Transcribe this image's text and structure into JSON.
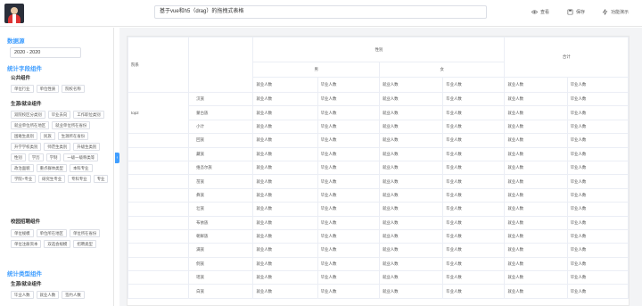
{
  "header": {
    "title": "基于vue和h5（drag）的拖拽式表格",
    "buttons": [
      {
        "icon": "eye-icon",
        "label": "查看"
      },
      {
        "icon": "save-icon",
        "label": "保存"
      },
      {
        "icon": "lightning-icon",
        "label": "功能演示"
      }
    ]
  },
  "sidebar": {
    "dataset_title": "数据源",
    "dataset_value": "2020 - 2020",
    "stat_title": "统计字段组件",
    "public_title": "公共组件",
    "public_chips": [
      "单位行业",
      "单位性质",
      "院校名称"
    ],
    "employment_title": "生源/就业组件",
    "employment_chips": [
      "双院校区分类别",
      "毕业去向",
      "工作职位类别",
      "就业单位所在地区",
      "就业单位所在省份",
      "困难生类别",
      "民族",
      "生源所在省份",
      "升学学校类别",
      "师范生类别",
      "升级生类别",
      "性别",
      "学历",
      "学制",
      "一级一级称类等",
      "政治面貌",
      "重点群体类型",
      "本科专业",
      "学院+专业",
      "研究生专业",
      "专科专业",
      "专业"
    ],
    "recruit_title": "校园招聘组件",
    "recruit_chips": [
      "单位规模",
      "单位所在地区",
      "单位所在省份",
      "单位注册资本",
      "双选会规模",
      "招聘类型"
    ],
    "type_title": "统计类型组件",
    "type_sub_title": "生源/就业组件",
    "type_chips": [
      "毕业人数",
      "就业人数",
      "签约人数"
    ]
  },
  "table": {
    "col_college": "院系",
    "col_gender": "性别",
    "col_male": "男",
    "col_female": "女",
    "col_total": "合计",
    "metric_employed": "就业人数",
    "metric_graduates": "毕业人数",
    "group_name": "top2",
    "rows": [
      "汉族",
      "蒙古族",
      "小计",
      "回族",
      "藏族",
      "维吾尔族",
      "苗族",
      "彝族",
      "壮族",
      "布依族",
      "朝鲜族",
      "满族",
      "侗族",
      "瑶族",
      "白族"
    ]
  }
}
